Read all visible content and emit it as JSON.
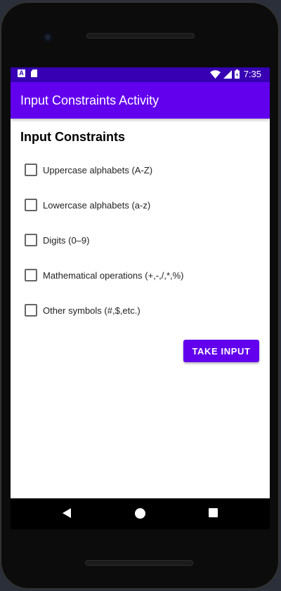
{
  "status_bar": {
    "time": "7:35",
    "left_icons": [
      "a-notification-icon",
      "sd-card-icon"
    ],
    "right_icons": [
      "wifi-icon",
      "signal-icon",
      "battery-icon"
    ],
    "notification_letter": "A"
  },
  "app_bar": {
    "title": "Input Constraints Activity",
    "color": "#6200ee"
  },
  "main": {
    "heading": "Input Constraints",
    "checkboxes": [
      {
        "label": "Uppercase alphabets (A-Z)",
        "checked": false
      },
      {
        "label": "Lowercase alphabets (a-z)",
        "checked": false
      },
      {
        "label": "Digits (0–9)",
        "checked": false
      },
      {
        "label": "Mathematical operations (+,-,/,*,%)",
        "checked": false
      },
      {
        "label": "Other symbols (#,$,etc.)",
        "checked": false
      }
    ],
    "take_input_label": "TAKE INPUT"
  },
  "nav_bar": {
    "icons": [
      "back-icon",
      "home-icon",
      "recents-icon"
    ]
  },
  "colors": {
    "primary": "#6200ee",
    "primary_dark": "#3700b3"
  }
}
